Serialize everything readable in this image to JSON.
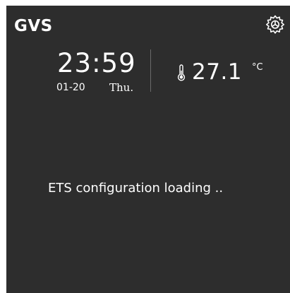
{
  "header": {
    "logo_text": "GVS",
    "settings_icon": "gear-icon"
  },
  "clock": {
    "time": "23:59",
    "date": "01-20",
    "weekday": "Thu."
  },
  "climate": {
    "thermometer_icon": "thermometer-icon",
    "temperature": "27.1",
    "unit": "°C"
  },
  "status": {
    "message": "ETS configuration loading .."
  },
  "colors": {
    "background": "#2d2d2d",
    "text": "#ffffff",
    "divider": "#6a6a6a"
  }
}
